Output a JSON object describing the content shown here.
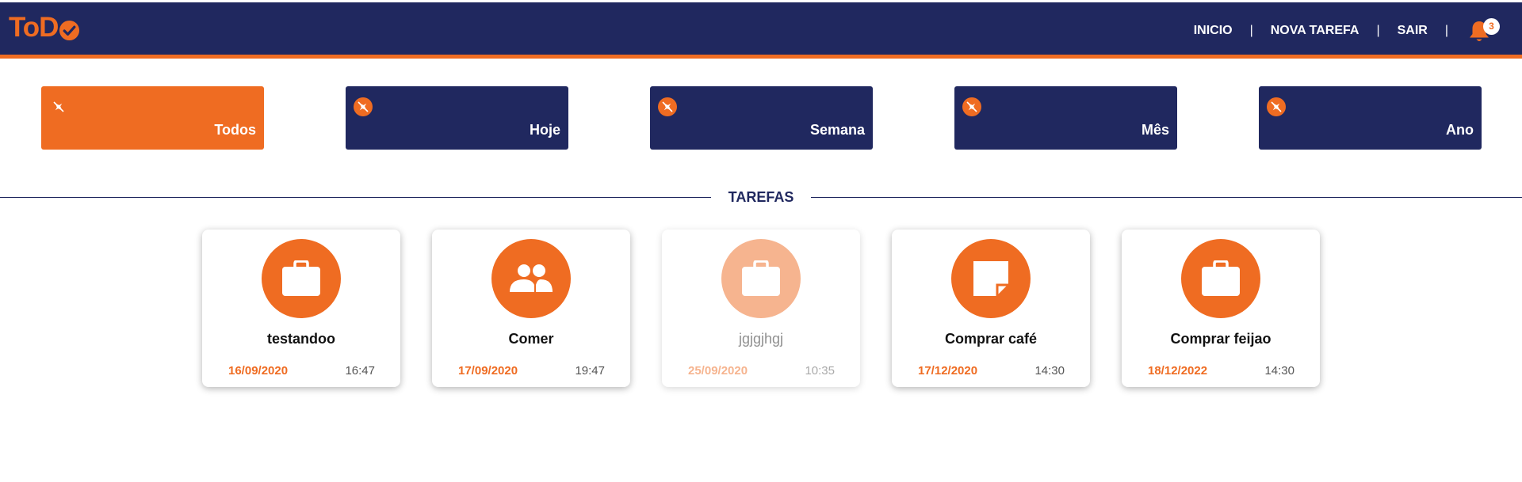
{
  "header": {
    "logo": "ToD",
    "nav": [
      "INICIO",
      "NOVA TAREFA",
      "SAIR"
    ],
    "separator": "|",
    "notification_count": "3"
  },
  "filters": [
    {
      "label": "Todos",
      "active": true
    },
    {
      "label": "Hoje",
      "active": false
    },
    {
      "label": "Semana",
      "active": false
    },
    {
      "label": "Mês",
      "active": false
    },
    {
      "label": "Ano",
      "active": false
    }
  ],
  "section_title": "TAREFAS",
  "tasks": [
    {
      "title": "testandoo",
      "date": "16/09/2020",
      "time": "16:47",
      "icon": "briefcase-icon",
      "faded": false
    },
    {
      "title": "Comer",
      "date": "17/09/2020",
      "time": "19:47",
      "icon": "people-icon",
      "faded": false
    },
    {
      "title": "jgjgjhgj",
      "date": "25/09/2020",
      "time": "10:35",
      "icon": "briefcase-icon",
      "faded": true
    },
    {
      "title": "Comprar café",
      "date": "17/12/2020",
      "time": "14:30",
      "icon": "sticky-note-icon",
      "faded": false
    },
    {
      "title": "Comprar feijao",
      "date": "18/12/2022",
      "time": "14:30",
      "icon": "briefcase-icon",
      "faded": false
    }
  ],
  "colors": {
    "navy": "#20285f",
    "orange": "#ef6c22"
  }
}
